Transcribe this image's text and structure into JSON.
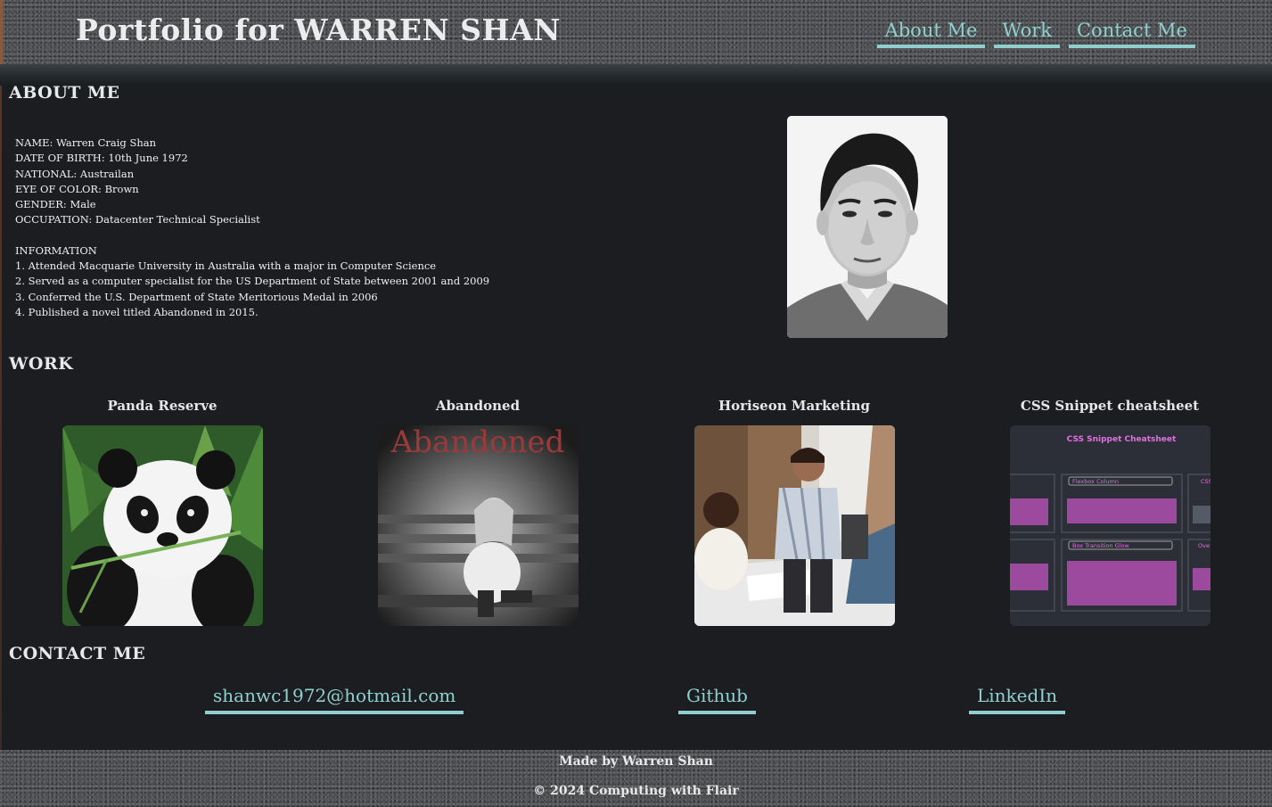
{
  "header": {
    "title": "Portfolio for WARREN SHAN",
    "nav": [
      "About Me",
      "Work",
      "Contact Me"
    ]
  },
  "about": {
    "heading": "ABOUT ME",
    "details": [
      "NAME: Warren Craig Shan",
      "DATE OF BIRTH: 10th June 1972",
      "NATIONAL: Austrailan",
      "EYE OF COLOR: Brown",
      "GENDER: Male",
      "OCCUPATION: Datacenter Technical Specialist"
    ],
    "info_heading": "INFORMATION",
    "info_items": [
      "1. Attended Macquarie University in Australia with a major in Computer Science",
      "2. Served as a computer specialist for the US Department of State between 2001 and 2009",
      "3. Conferred the U.S. Department of State Meritorious Medal in 2006",
      "4. Published a novel titled Abandoned in 2015."
    ]
  },
  "work": {
    "heading": "WORK",
    "projects": [
      {
        "title": "Panda Reserve"
      },
      {
        "title": "Abandoned",
        "cover_text": "Abandoned"
      },
      {
        "title": "Horiseon Marketing"
      },
      {
        "title": "CSS Snippet cheatsheet",
        "thumb_title": "CSS Snippet Cheatsheet",
        "thumb_cards": [
          "Flexbox Column",
          "Box Transition Glow",
          "CSS",
          "Ove"
        ]
      }
    ]
  },
  "contact": {
    "heading": "CONTACT ME",
    "links": [
      "shanwc1972@hotmail.com",
      "Github",
      "LinkedIn"
    ]
  },
  "footer": {
    "line1": "Made by Warren Shan",
    "line2": "© 2024 Computing with Flair"
  },
  "colors": {
    "background": "#1b1d20",
    "accent": "#8fd0d0",
    "text": "#e8e8e8",
    "bar": "#55575a"
  }
}
